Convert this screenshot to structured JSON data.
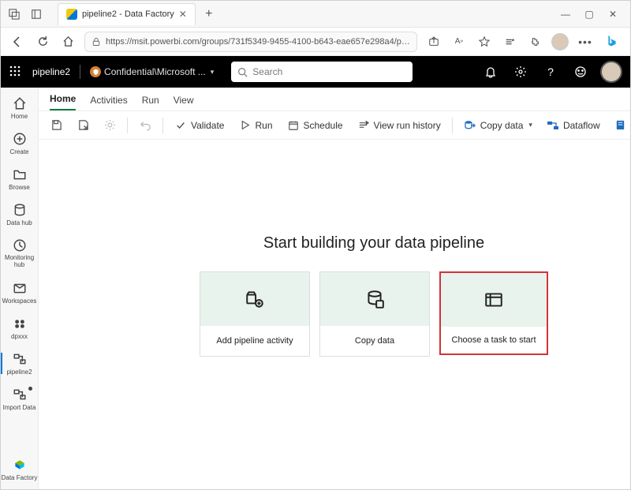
{
  "browser": {
    "tab_title": "pipeline2 - Data Factory",
    "url": "https://msit.powerbi.com/groups/731f5349-9455-4100-b643-eae657e298a4/pip..."
  },
  "appbar": {
    "breadcrumb": "pipeline2",
    "sensitivity": "Confidential\\Microsoft ...",
    "search_placeholder": "Search"
  },
  "leftnav": {
    "items": [
      {
        "label": "Home"
      },
      {
        "label": "Create"
      },
      {
        "label": "Browse"
      },
      {
        "label": "Data hub"
      },
      {
        "label": "Monitoring hub"
      },
      {
        "label": "Workspaces"
      },
      {
        "label": "dpxxx"
      },
      {
        "label": "pipeline2"
      },
      {
        "label": "Import Data"
      }
    ],
    "footer": {
      "label": "Data Factory"
    }
  },
  "ribbon_tabs": [
    "Home",
    "Activities",
    "Run",
    "View"
  ],
  "toolbar": {
    "validate": "Validate",
    "run": "Run",
    "schedule": "Schedule",
    "view_run_history": "View run history",
    "copy_data": "Copy data",
    "dataflow": "Dataflow",
    "notebook": "Notebook"
  },
  "canvas": {
    "heading": "Start building your data pipeline",
    "cards": [
      {
        "label": "Add pipeline activity"
      },
      {
        "label": "Copy data"
      },
      {
        "label": "Choose a task to start"
      }
    ]
  }
}
